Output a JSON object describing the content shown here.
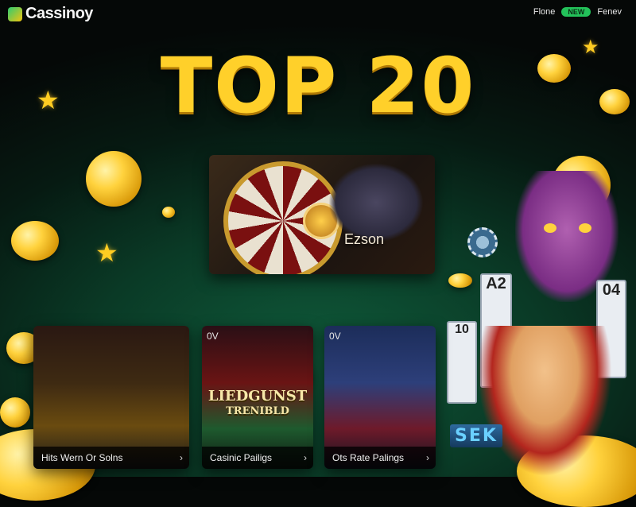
{
  "header": {
    "logo_text": "Cassinoy",
    "nav_left": "Flone",
    "nav_pill": "NEW",
    "nav_right": "Fenev"
  },
  "hero": {
    "title": "TOP 20"
  },
  "featured": {
    "label": "Ezson"
  },
  "cards": [
    {
      "tag": "",
      "title": "",
      "subtitle": "",
      "footer": "Hits Wern Or Solns"
    },
    {
      "tag": "0V",
      "title": "LIEDGUNST",
      "subtitle": "TRENIBLD",
      "footer": "Casinic Pailigs"
    },
    {
      "tag": "0V",
      "title": "",
      "subtitle": "",
      "footer": "Ots Rate Palings"
    }
  ],
  "decor": {
    "blocks_text": "SEK",
    "card_a": "A2",
    "card_b": "04",
    "card_c": "10"
  },
  "colors": {
    "accent_gold": "#ffd02a",
    "pill_green": "#23c25a",
    "background": "#0a3a26"
  }
}
